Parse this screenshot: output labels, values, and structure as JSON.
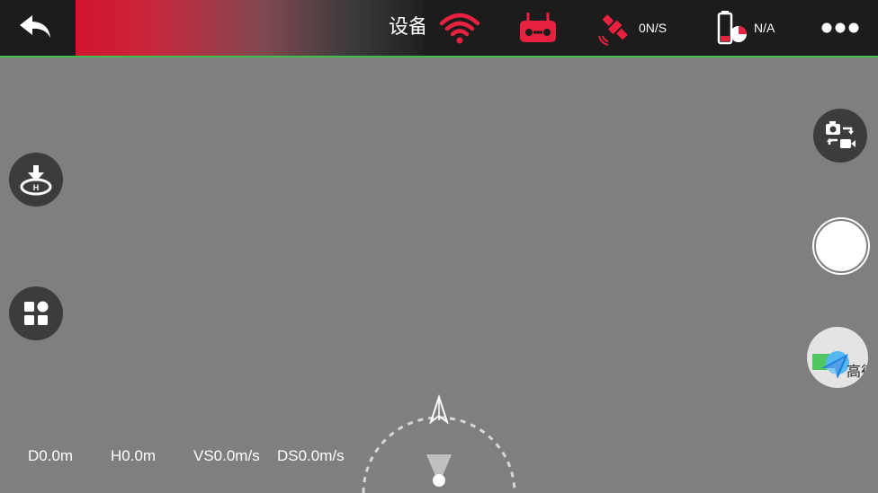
{
  "header": {
    "banner_text": "设备",
    "gps_speed": "0N/S",
    "battery_status": "N/A"
  },
  "telemetry": {
    "distance": "D0.0m",
    "height": "H0.0m",
    "vertical_speed": "VS0.0m/s",
    "horizontal_speed": "DS0.0m/s"
  },
  "map": {
    "label": "高德"
  },
  "colors": {
    "accent_red": "#e8213f",
    "topbar_bg": "#1c1c1c",
    "divider_green": "#3fbf4a",
    "viewport_bg": "#7f7f7f"
  },
  "icons": {
    "back": "back-arrow-icon",
    "wifi": "wifi-signal-icon",
    "remote": "remote-controller-icon",
    "satellite": "satellite-icon",
    "battery": "battery-icon",
    "more": "more-dots-icon",
    "takeoff": "takeoff-land-icon",
    "apps": "apps-grid-icon",
    "camera_switch": "camera-switch-icon",
    "shutter": "shutter-icon",
    "map": "map-navigation-icon",
    "compass": "compass-icon"
  }
}
